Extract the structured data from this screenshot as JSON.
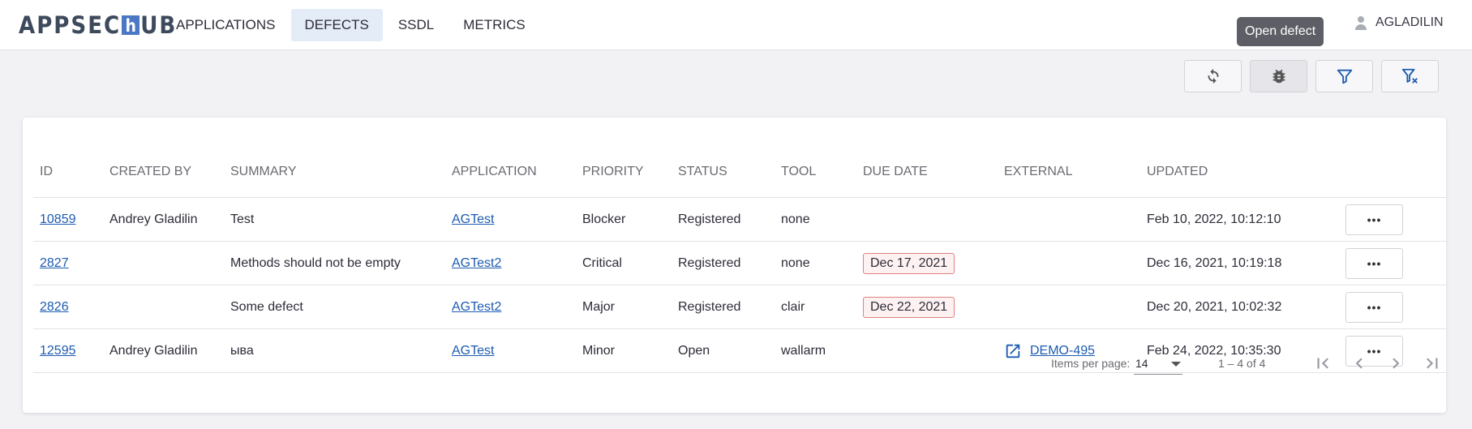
{
  "header": {
    "logo_left": "APPSEC",
    "logo_mid": "h",
    "logo_right": "UB",
    "nav": [
      {
        "label": "APPLICATIONS"
      },
      {
        "label": "DEFECTS"
      },
      {
        "label": "SSDL"
      },
      {
        "label": "METRICS"
      }
    ],
    "user": "AGLADILIN",
    "tooltip": "Open defect"
  },
  "toolbar": {
    "buttons": [
      "refresh-icon",
      "bug-icon",
      "filter-icon",
      "clear-filter-icon"
    ]
  },
  "table": {
    "columns": [
      "ID",
      "CREATED BY",
      "SUMMARY",
      "APPLICATION",
      "PRIORITY",
      "STATUS",
      "TOOL",
      "DUE DATE",
      "EXTERNAL",
      "UPDATED"
    ],
    "rows": [
      {
        "id": "10859",
        "created_by": "Andrey Gladilin",
        "summary": "Test",
        "application": "AGTest",
        "priority": "Blocker",
        "status": "Registered",
        "tool": "none",
        "due": "",
        "external": "",
        "updated": "Feb 10, 2022, 10:12:10"
      },
      {
        "id": "2827",
        "created_by": "",
        "summary": "Methods should not be empty",
        "application": "AGTest2",
        "priority": "Critical",
        "status": "Registered",
        "tool": "none",
        "due": "Dec 17, 2021",
        "external": "",
        "updated": "Dec 16, 2021, 10:19:18"
      },
      {
        "id": "2826",
        "created_by": "",
        "summary": "Some defect",
        "application": "AGTest2",
        "priority": "Major",
        "status": "Registered",
        "tool": "clair",
        "due": "Dec 22, 2021",
        "external": "",
        "updated": "Dec 20, 2021, 10:02:32"
      },
      {
        "id": "12595",
        "created_by": "Andrey Gladilin",
        "summary": "ыва",
        "application": "AGTest",
        "priority": "Minor",
        "status": "Open",
        "tool": "wallarm",
        "due": "",
        "external": "DEMO-495",
        "updated": "Feb 24, 2022, 10:35:30"
      }
    ],
    "more_label": "•••"
  },
  "paginator": {
    "items_per_page_label": "Items per page:",
    "items_per_page_value": "14",
    "range": "1 – 4 of 4"
  },
  "colors": {
    "link": "#1d5bb0",
    "due_border": "#e08080",
    "accent": "#4a78c4"
  }
}
